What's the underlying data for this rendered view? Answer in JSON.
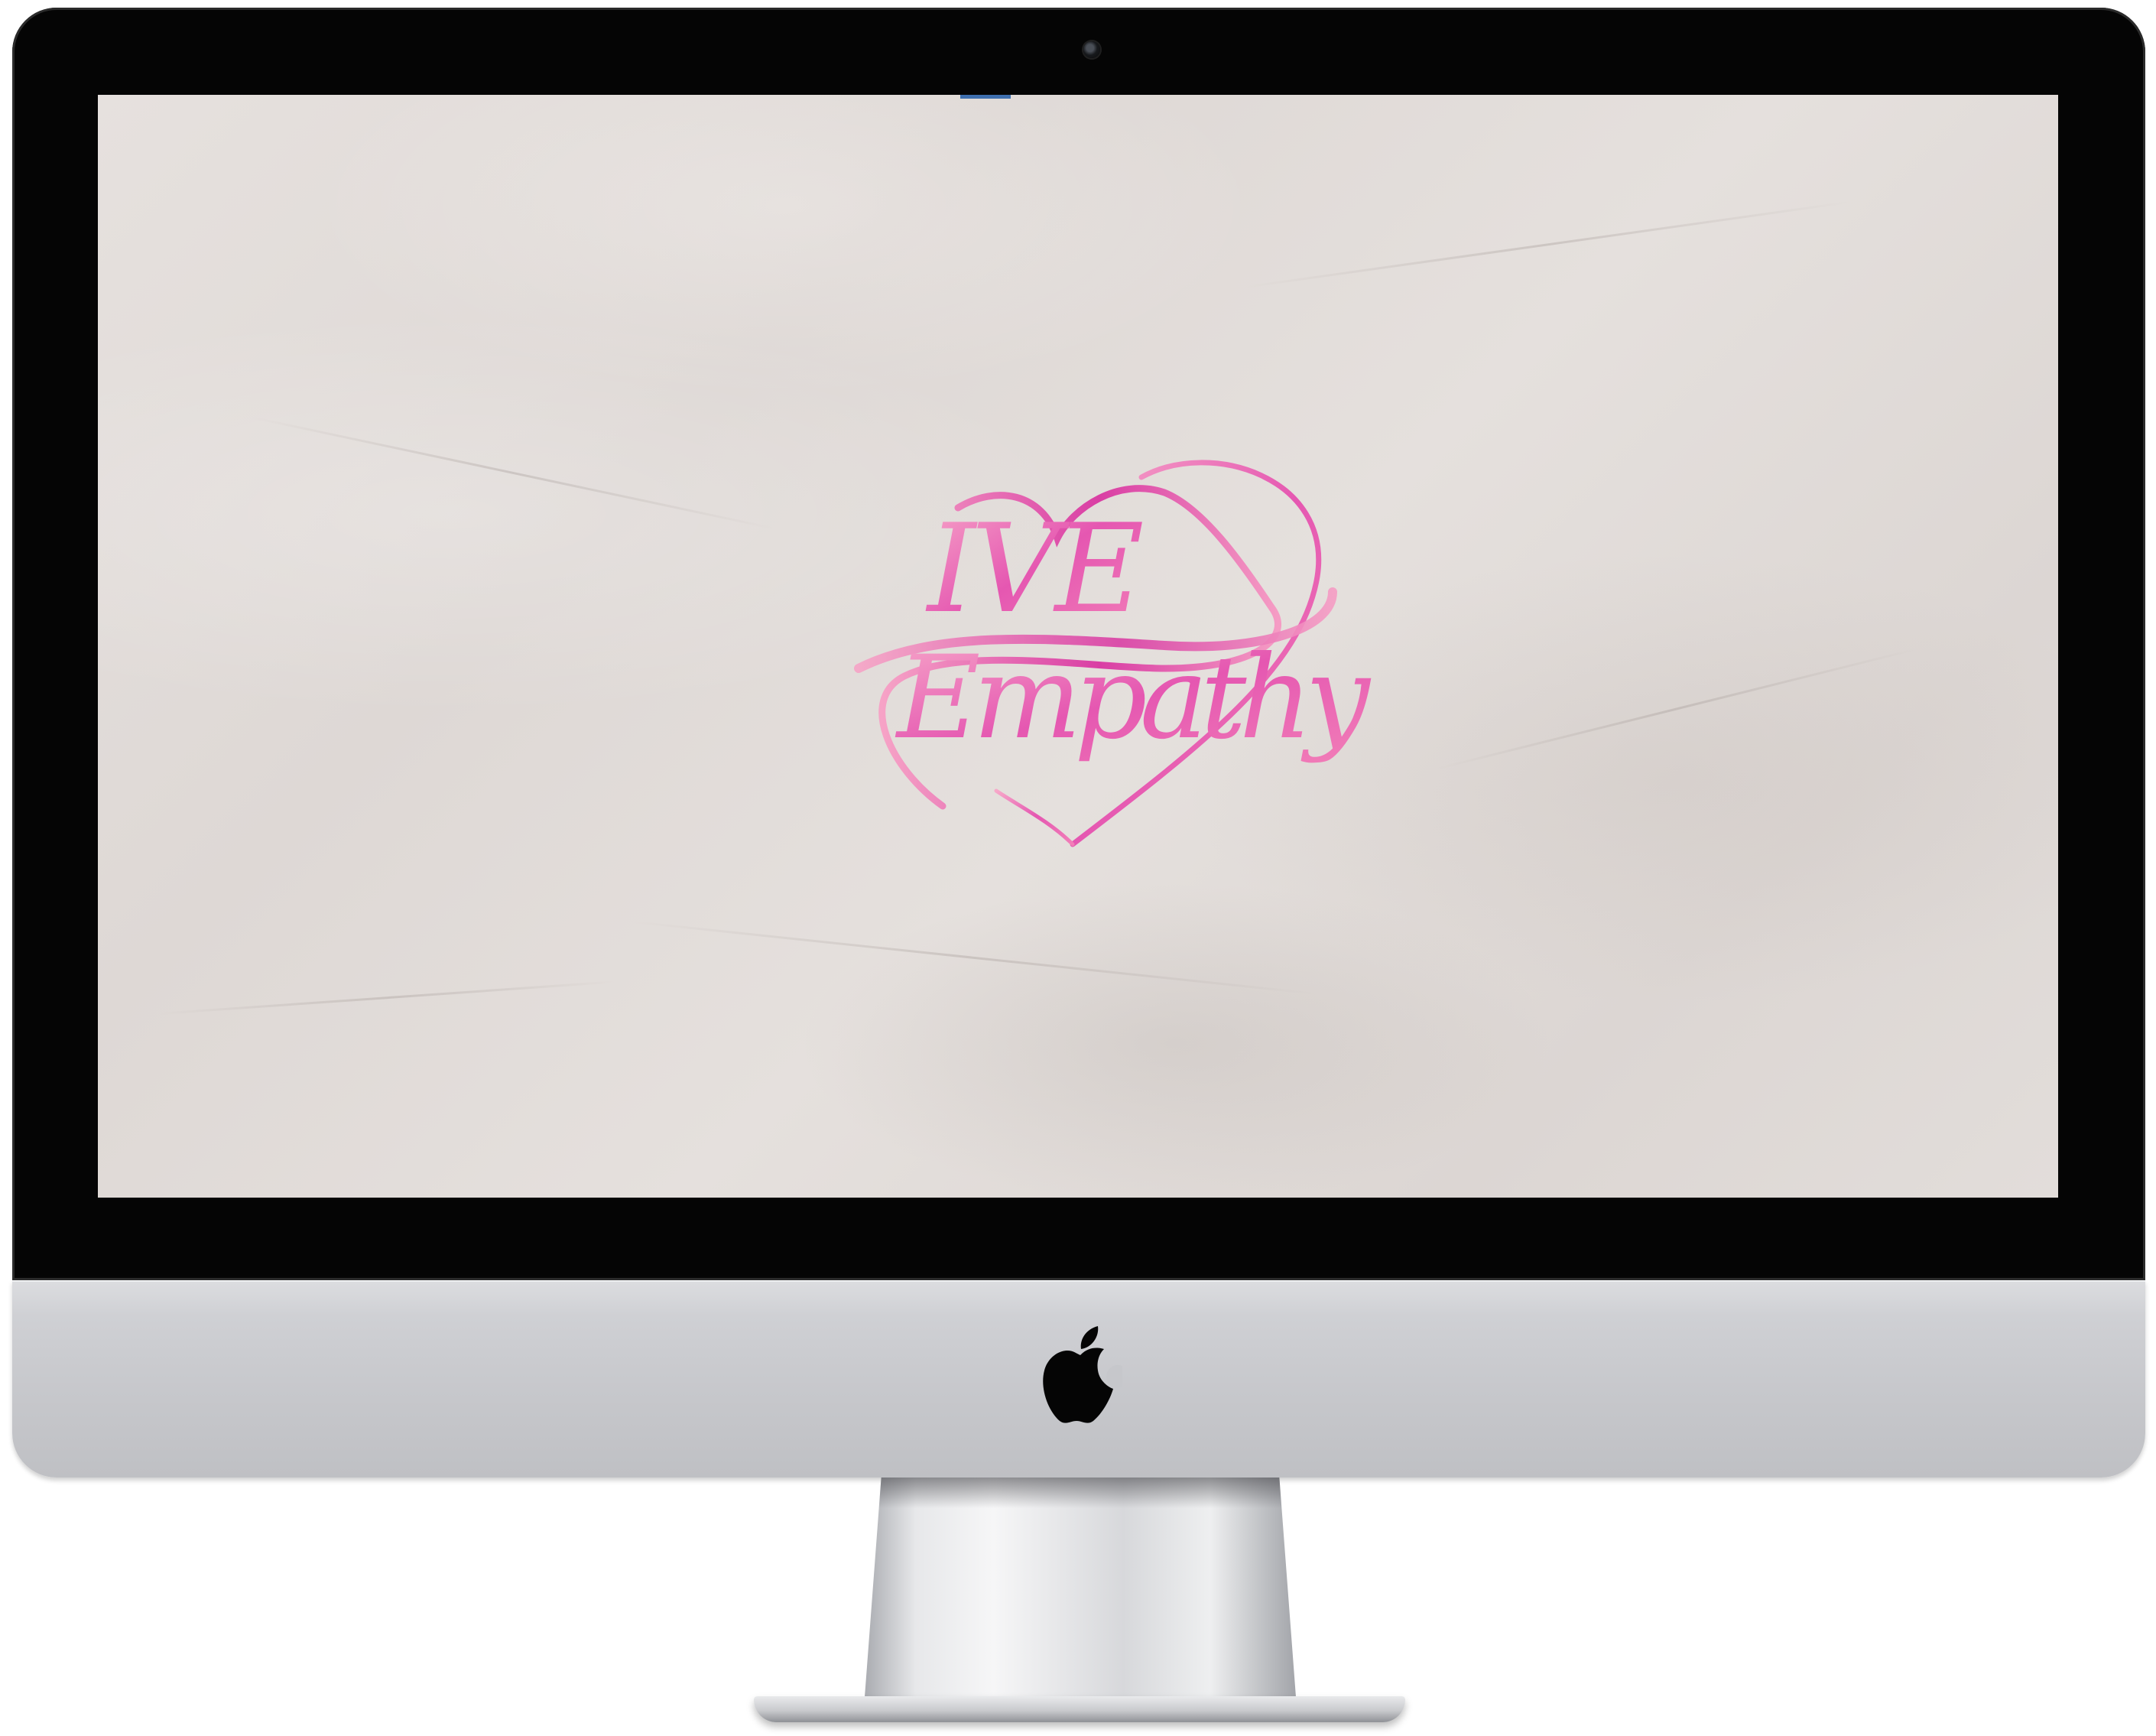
{
  "device": {
    "type": "iMac",
    "bezel_color": "#050505",
    "chin_color": "#c6c7cb",
    "icons": [
      "camera-icon",
      "apple-logo-icon"
    ]
  },
  "screen": {
    "wallpaper": "crumpled-paper",
    "background_color": "#e2ddda",
    "logo": {
      "line_1": "IVE",
      "line_2": "Empathy",
      "color_light": "#f49ac1",
      "color_dark": "#d12c9a",
      "shape": "heart-ribbon"
    }
  }
}
